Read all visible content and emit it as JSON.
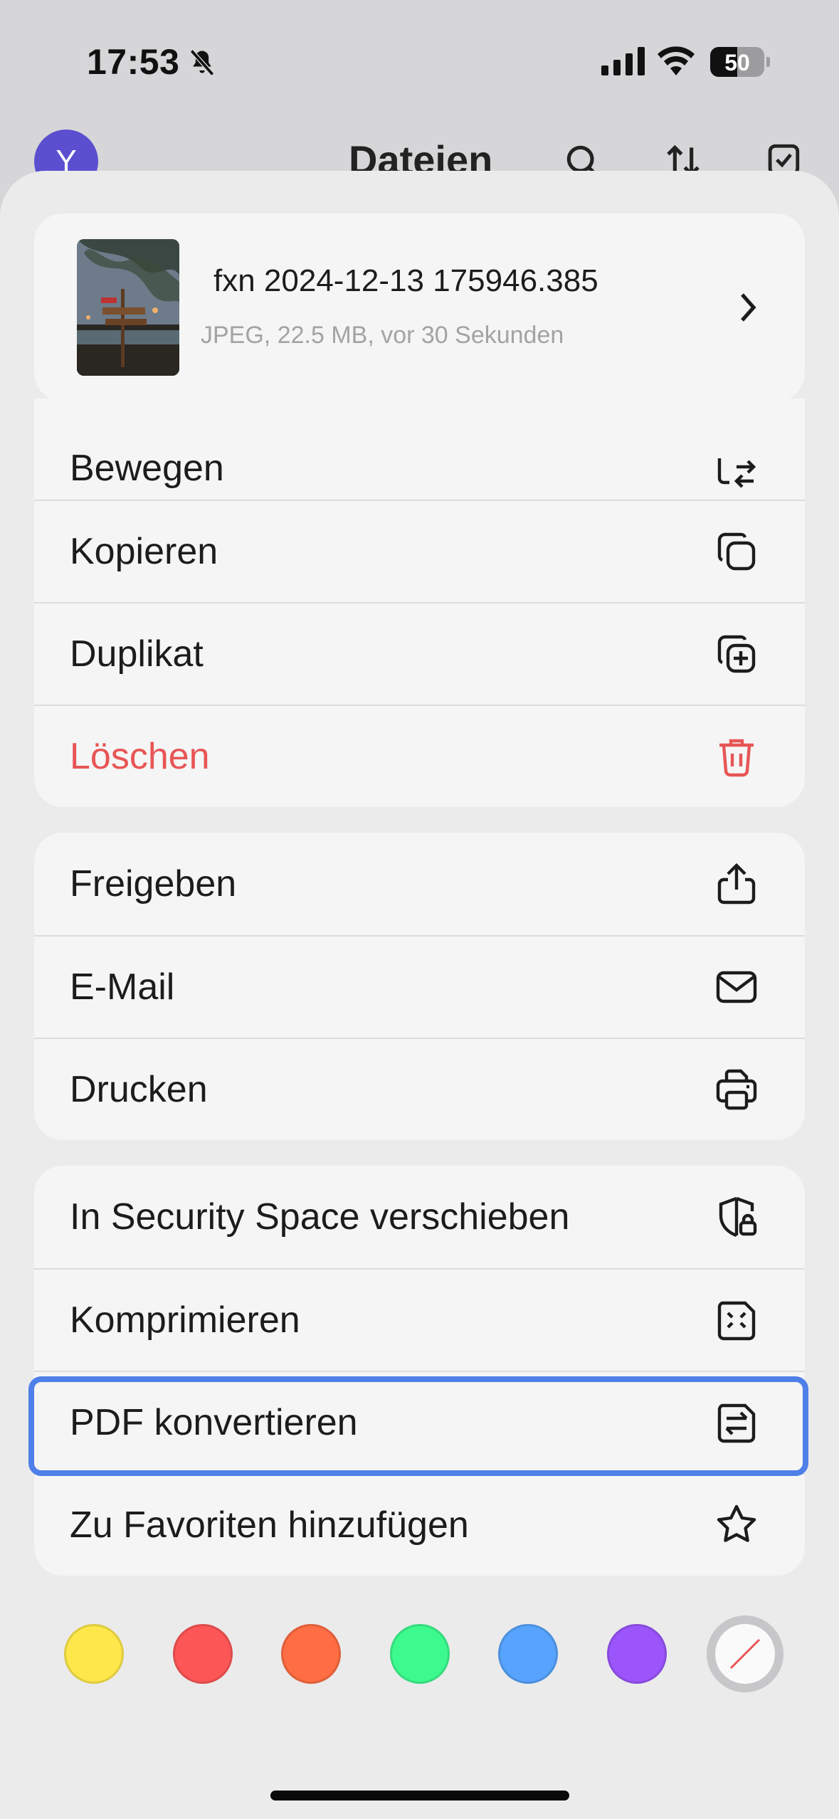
{
  "status_bar": {
    "time": "17:53",
    "battery": "50",
    "battery_level": 0.5
  },
  "header": {
    "avatar_letter": "Y",
    "title": "Dateien"
  },
  "file": {
    "name": "fxn 2024-12-13 175946.385",
    "meta": "JPEG, 22.5 MB, vor 30 Sekunden"
  },
  "menu": {
    "group1": [
      {
        "label": "Bewegen",
        "icon": "move-icon"
      },
      {
        "label": "Kopieren",
        "icon": "copy-icon"
      },
      {
        "label": "Duplikat",
        "icon": "duplicate-icon"
      },
      {
        "label": "Löschen",
        "icon": "trash-icon",
        "color": "#e85555"
      }
    ],
    "group2": [
      {
        "label": "Freigeben",
        "icon": "share-icon"
      },
      {
        "label": "E-Mail",
        "icon": "mail-icon"
      },
      {
        "label": "Drucken",
        "icon": "printer-icon"
      }
    ],
    "group3": [
      {
        "label": "In Security Space verschieben",
        "icon": "shield-lock-icon"
      },
      {
        "label": "Komprimieren",
        "icon": "compress-icon"
      },
      {
        "label": "PDF konvertieren",
        "icon": "convert-icon"
      },
      {
        "label": "Zu Favoriten hinzufügen",
        "icon": "star-icon"
      }
    ]
  },
  "color_tags": [
    "#fde74a",
    "#fd5656",
    "#fe6d43",
    "#3dfa8f",
    "#57a3fd",
    "#9b55fb"
  ],
  "accent_color": "#4f7fe8"
}
